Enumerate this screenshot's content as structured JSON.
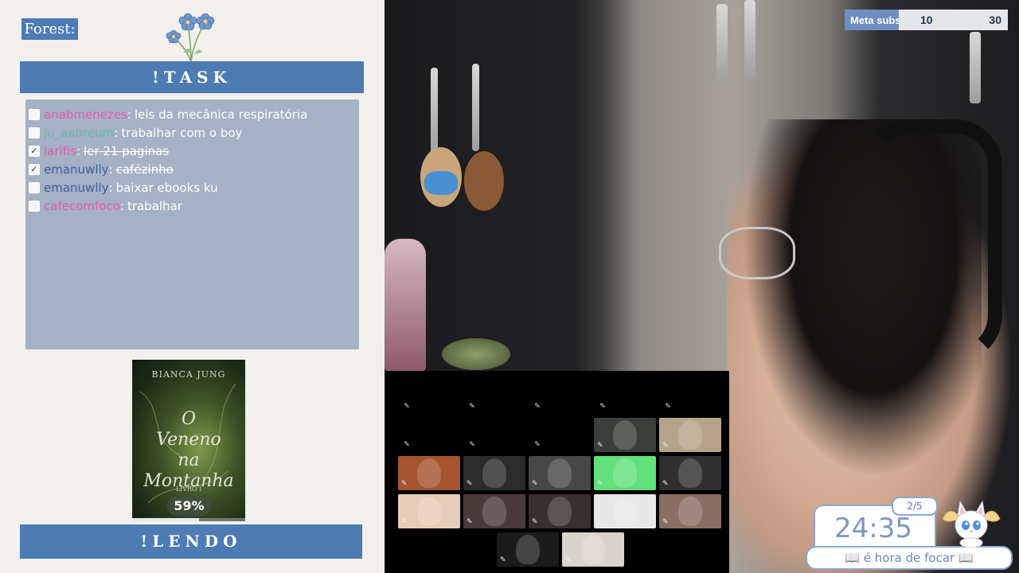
{
  "left_panel": {
    "forest_label": "Forest:",
    "task_header": "!TASK",
    "lendo_header": "!LENDO",
    "tasks": [
      {
        "user": "anabmenezes",
        "user_color": "#e45bb0",
        "text": "leis da mecânica respiratória",
        "done": false
      },
      {
        "user": "ju_aabreum",
        "user_color": "#6fb6ad",
        "text": "trabalhar com o boy",
        "done": false
      },
      {
        "user": "larifis",
        "user_color": "#e45bb0",
        "text": "ler 21 paginas",
        "done": true
      },
      {
        "user": "emanuwlly",
        "user_color": "#3c5fa6",
        "text": "cafézinho",
        "done": true
      },
      {
        "user": "emanuwlly",
        "user_color": "#3c5fa6",
        "text": "baixar ebooks ku",
        "done": false
      },
      {
        "user": "cafecomfoco",
        "user_color": "#e45bb0",
        "text": "trabalhar",
        "done": false
      }
    ],
    "book": {
      "author": "BIANCA JUNG",
      "title_line1": "O",
      "title_line2": "Veneno",
      "title_line3": "na",
      "title_line4": "Montanha",
      "subtitle": "LIVRO I",
      "progress_label": "59%",
      "progress_fraction": 0.59
    }
  },
  "subs": {
    "label": "Meta subs",
    "current": "10",
    "goal": "30",
    "fraction": 0.333
  },
  "call": {
    "mic_glyph": "✎",
    "tile_colors": [
      "#3a3e3a",
      "#b6a48a",
      "#a4542e",
      "#2b2b2b",
      "#474747",
      "#62e07a",
      "#2f2f2f",
      "#e9cbb9",
      "#4b3a3a",
      "#3a2e2e",
      "#e8e8e8",
      "#8a6e63",
      "#1b1b1b",
      "#d9d3cd"
    ]
  },
  "timer": {
    "session": "2/5",
    "time": "24:35",
    "caption": "📖 é hora de focar 📖"
  },
  "colors": {
    "accent_blue": "#4d7bb3",
    "task_card": "#a5b1c4",
    "timer_border": "#8ea7cf"
  }
}
